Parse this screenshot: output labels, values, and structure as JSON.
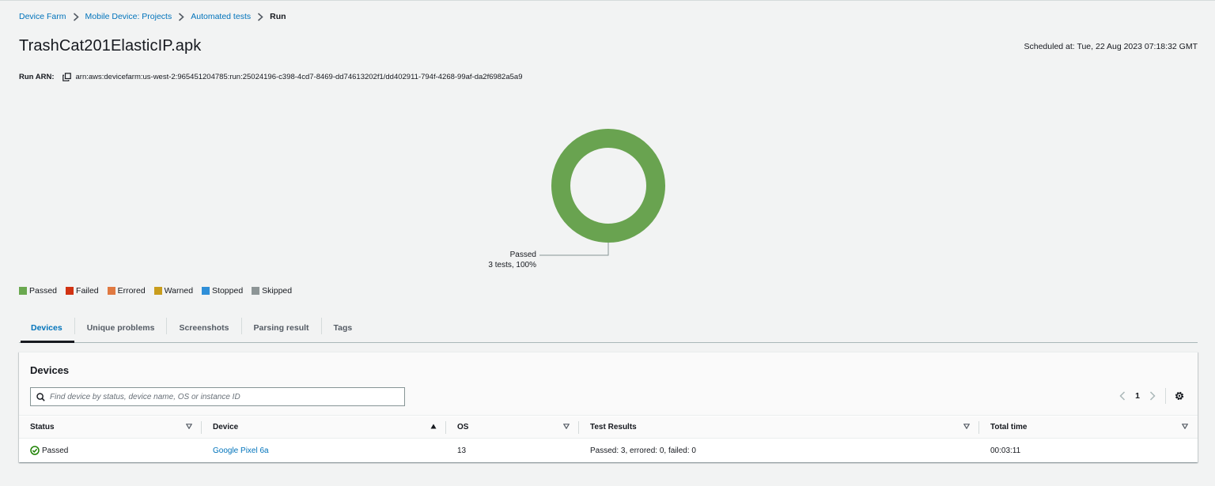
{
  "breadcrumb": {
    "items": [
      "Device Farm",
      "Mobile Device: Projects",
      "Automated tests"
    ],
    "current": "Run"
  },
  "header": {
    "title": "TrashCat201ElasticIP.apk",
    "scheduled": "Scheduled at: Tue, 22 Aug 2023 07:18:32 GMT"
  },
  "arn": {
    "label": "Run ARN:",
    "value": "arn:aws:devicefarm:us-west-2:965451204785:run:25024196-c398-4cd7-8469-dd74613202f1/dd402911-794f-4268-99af-da2f6982a5a9"
  },
  "chart_data": {
    "type": "pie",
    "donut": true,
    "categories": [
      "Passed"
    ],
    "values": [
      100
    ],
    "colors": [
      "#69a350"
    ],
    "annotations": [
      {
        "category": "Passed",
        "line1": "Passed",
        "line2": "3 tests, 100%"
      }
    ]
  },
  "legend": [
    {
      "label": "Passed",
      "color": "#6aa84f"
    },
    {
      "label": "Failed",
      "color": "#d13212"
    },
    {
      "label": "Errored",
      "color": "#e07941"
    },
    {
      "label": "Warned",
      "color": "#c99d1d"
    },
    {
      "label": "Stopped",
      "color": "#2f8fd8"
    },
    {
      "label": "Skipped",
      "color": "#8d9596"
    }
  ],
  "tabs": {
    "devices": "Devices",
    "unique_problems": "Unique problems",
    "screenshots": "Screenshots",
    "parsing_result": "Parsing result",
    "tags": "Tags"
  },
  "devices_panel": {
    "title": "Devices",
    "search_placeholder": "Find device by status, device name, OS or instance ID",
    "page": "1"
  },
  "table": {
    "columns": [
      "Status",
      "Device",
      "OS",
      "Test Results",
      "Total time"
    ],
    "rows": [
      {
        "status": "Passed",
        "device": "Google Pixel 6a",
        "os": "13",
        "results": "Passed: 3, errored: 0, failed: 0",
        "time": "00:03:11"
      }
    ]
  },
  "colors": {
    "link": "#0073bb",
    "passed": "#1d8102",
    "donut": "#69a350"
  }
}
